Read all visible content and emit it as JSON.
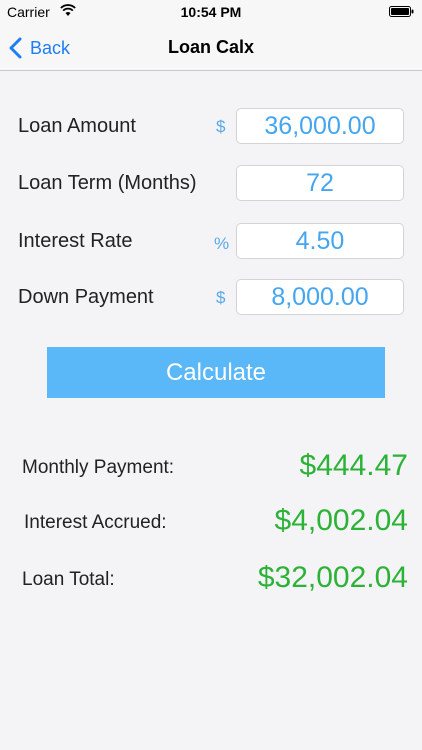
{
  "status_bar": {
    "carrier": "Carrier",
    "time": "10:54 PM",
    "wifi_icon": "wifi-icon",
    "battery_icon": "battery-icon"
  },
  "nav": {
    "back_label": "Back",
    "title": "Loan Calx"
  },
  "form": {
    "loan_amount": {
      "label": "Loan Amount",
      "unit": "$",
      "value": "36,000.00"
    },
    "loan_term": {
      "label": "Loan Term (Months)",
      "value": "72"
    },
    "interest_rate": {
      "label": "Interest Rate",
      "unit": "%",
      "value": "4.50"
    },
    "down_payment": {
      "label": "Down Payment",
      "unit": "$",
      "value": "8,000.00"
    }
  },
  "calculate_label": "Calculate",
  "results": {
    "monthly_payment": {
      "label": "Monthly Payment:",
      "value": "$444.47"
    },
    "interest_accrued": {
      "label": "Interest Accrued:",
      "value": "$4,002.04"
    },
    "loan_total": {
      "label": "Loan Total:",
      "value": "$32,002.04"
    }
  },
  "colors": {
    "accent": "#1f7ef5",
    "field_text": "#45a6ef",
    "button": "#5ab8f8",
    "result": "#2bb237"
  }
}
